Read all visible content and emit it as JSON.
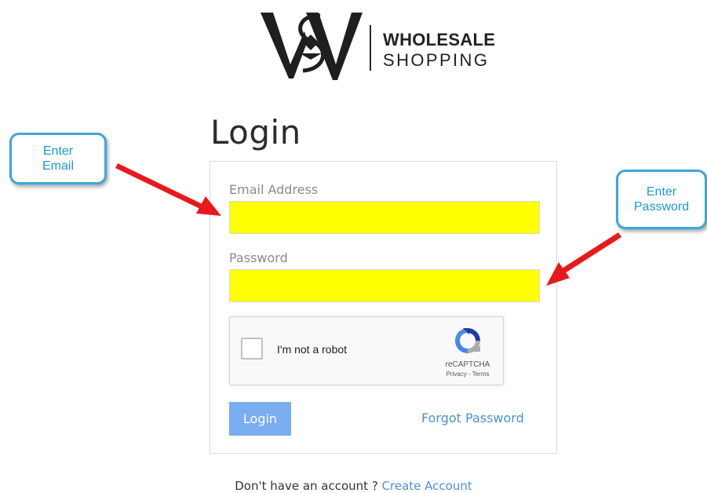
{
  "brand": {
    "line1": "WHOLESALE",
    "line2": "SHOPPING"
  },
  "page": {
    "title": "Login"
  },
  "form": {
    "email_label": "Email Address",
    "email_value": "",
    "password_label": "Password",
    "password_value": "",
    "login_button": "Login",
    "forgot_password": "Forgot Password"
  },
  "recaptcha": {
    "label": "I'm not a robot",
    "brand": "reCAPTCHA",
    "links": "Privacy - Terms"
  },
  "signup": {
    "prompt": "Don't have an account ? ",
    "link": "Create Account"
  },
  "annotations": {
    "email_callout": "Enter Email",
    "password_callout": "Enter Password"
  },
  "colors": {
    "input_highlight": "#ffff00",
    "button": "#79aef0",
    "link": "#4a90d9",
    "callout_border": "#3ea6d8",
    "callout_text": "#1a9ad6",
    "arrow": "#e8191c"
  }
}
